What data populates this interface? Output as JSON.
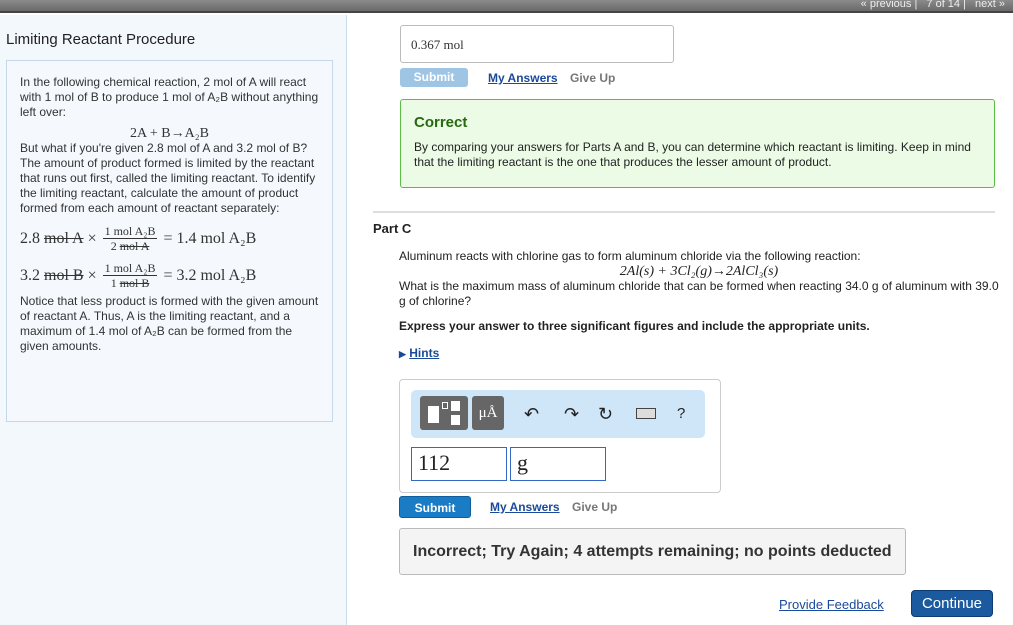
{
  "nav": {
    "previous": "« previous",
    "position": "7 of 14",
    "next": "next »"
  },
  "left": {
    "title": "Limiting Reactant Procedure",
    "intro_1": "In the following chemical reaction, 2 mol of A will react with 1 mol of B to produce 1 mol of A₂B without anything left over:",
    "reaction": "2A + B→A₂B",
    "para_2": "But what if you're given 2.8 mol of A and 3.2 mol of B? The amount of product formed is limited by the reactant that runs out first, called the limiting reactant. To identify the limiting reactant, calculate the amount of product formed from each amount of reactant separately:",
    "eq1": {
      "qty": "2.8",
      "unit": "mol A",
      "num": "1 mol A₂B",
      "den_n": "2",
      "den_u": "mol A",
      "result": "= 1.4 mol A₂B"
    },
    "eq2": {
      "qty": "3.2",
      "unit": "mol B",
      "num": "1 mol A₂B",
      "den_n": "1",
      "den_u": "mol B",
      "result": "= 3.2 mol A₂B"
    },
    "conclusion": "Notice that less product is formed with the given amount of reactant A. Thus, A is the limiting reactant, and a maximum of 1.4 mol of A₂B can be formed from the given amounts."
  },
  "partB": {
    "answer": "0.367 mol",
    "submit": "Submit",
    "my_answers": "My Answers",
    "give_up": "Give Up",
    "feedback_title": "Correct",
    "feedback_text": "By comparing your answers for Parts A and B, you can determine which reactant is limiting. Keep in mind that the limiting reactant is the one that produces the lesser amount of product."
  },
  "partC": {
    "label": "Part C",
    "question_1": "Aluminum reacts with chlorine gas to form aluminum chloride via the following reaction:",
    "reaction": "2Al(s) + 3Cl₂(g)→2AlCl₃(s)",
    "question_2": "What is the maximum mass of aluminum chloride that can be formed when reacting 34.0 g of aluminum with 39.0 g of chlorine?",
    "instruction": "Express your answer to three significant figures and include the appropriate units.",
    "hints": "Hints",
    "toolbar": {
      "units_button": "μÅ",
      "help": "?"
    },
    "value": "112",
    "unit": "g",
    "submit": "Submit",
    "my_answers": "My Answers",
    "give_up": "Give Up",
    "feedback": "Incorrect; Try Again; 4 attempts remaining; no points deducted"
  },
  "footer": {
    "provide_feedback": "Provide Feedback",
    "continue": "Continue"
  },
  "colors": {
    "submit_active": "#1a7cc4",
    "submit_disabled": "#9fc5e4",
    "correct_bg": "#ecfbe6",
    "continue": "#1c5aa0"
  }
}
